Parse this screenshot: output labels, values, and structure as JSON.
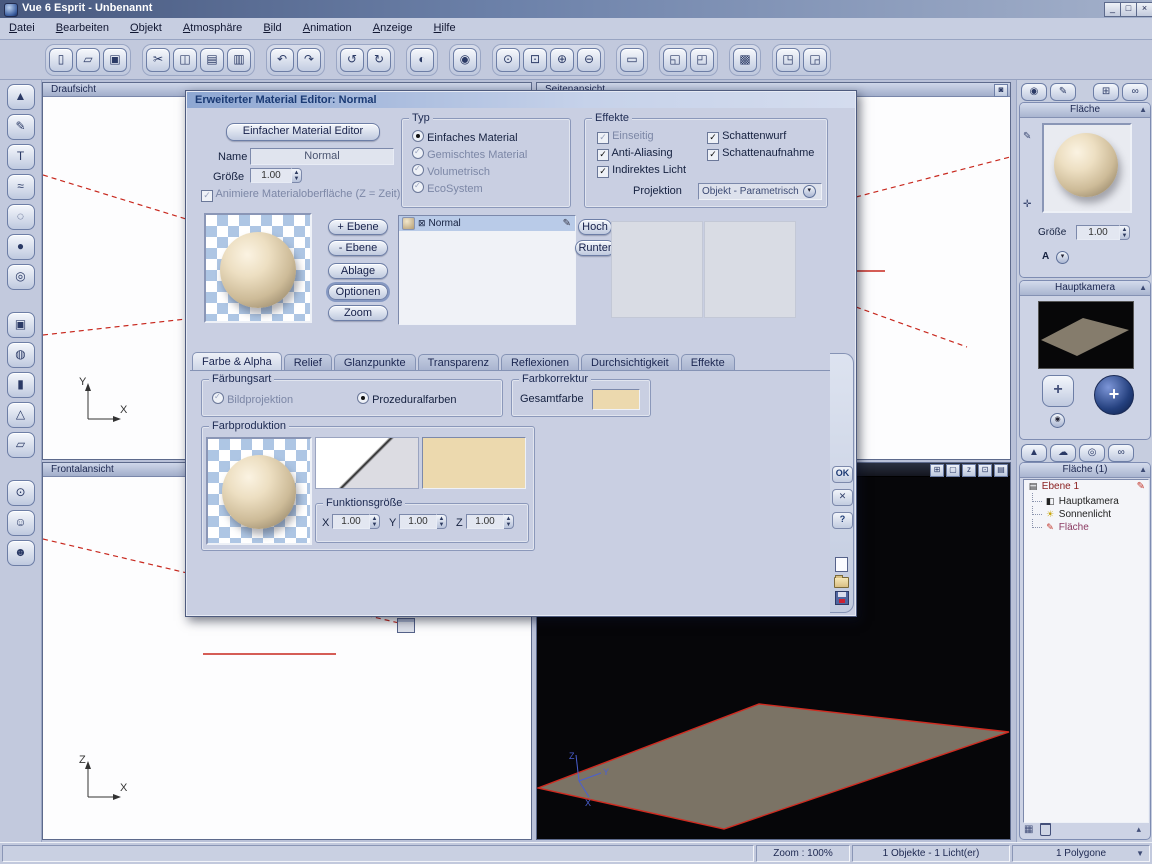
{
  "window": {
    "title": "Vue 6 Esprit - Unbenannt",
    "buttons": {
      "minimize": "_",
      "maximize": "□",
      "close": "×"
    }
  },
  "menubar": {
    "items": [
      {
        "label": "Datei"
      },
      {
        "label": "Bearbeiten"
      },
      {
        "label": "Objekt"
      },
      {
        "label": "Atmosphäre"
      },
      {
        "label": "Bild"
      },
      {
        "label": "Animation"
      },
      {
        "label": "Anzeige"
      },
      {
        "label": "Hilfe"
      }
    ]
  },
  "toolbar": {
    "groups": [
      {
        "items": [
          {
            "name": "new-scene-icon",
            "glyph": "▯"
          },
          {
            "name": "open-scene-icon",
            "glyph": "▱"
          },
          {
            "name": "save-scene-icon",
            "glyph": "▣"
          }
        ]
      },
      {
        "items": [
          {
            "name": "cut-icon",
            "glyph": "✂"
          },
          {
            "name": "copy-icon",
            "glyph": "◫"
          },
          {
            "name": "paste-icon",
            "glyph": "▤"
          },
          {
            "name": "duplicate-icon",
            "glyph": "▥"
          }
        ]
      },
      {
        "items": [
          {
            "name": "undo-icon",
            "glyph": "↶"
          },
          {
            "name": "redo-icon",
            "glyph": "↷"
          }
        ]
      },
      {
        "items": [
          {
            "name": "rotate-left-icon",
            "glyph": "↺"
          },
          {
            "name": "rotate-right-icon",
            "glyph": "↻"
          }
        ]
      },
      {
        "items": [
          {
            "name": "render-icon",
            "glyph": "◐"
          }
        ]
      },
      {
        "items": [
          {
            "name": "visibility-icon",
            "glyph": "◉"
          }
        ]
      },
      {
        "items": [
          {
            "name": "zoom-tool-icon",
            "glyph": "⊙"
          },
          {
            "name": "zoom-region-icon",
            "glyph": "⊡"
          },
          {
            "name": "zoom-in-icon",
            "glyph": "⊕"
          },
          {
            "name": "zoom-out-icon",
            "glyph": "⊖"
          }
        ]
      },
      {
        "items": [
          {
            "name": "single-view-icon",
            "glyph": "▭"
          }
        ]
      },
      {
        "items": [
          {
            "name": "quad-view-icon",
            "glyph": "◱"
          },
          {
            "name": "layout-view-icon",
            "glyph": "◰"
          }
        ]
      },
      {
        "items": [
          {
            "name": "render-options-icon",
            "glyph": "▩"
          }
        ]
      },
      {
        "items": [
          {
            "name": "object-options-icon",
            "glyph": "◳"
          },
          {
            "name": "camera-options-icon",
            "glyph": "◲"
          }
        ]
      }
    ]
  },
  "tools": {
    "items": [
      {
        "name": "terrain-tool-icon",
        "glyph": "▲"
      },
      {
        "name": "pen-tool-icon",
        "glyph": "✎"
      },
      {
        "name": "text-tool-icon",
        "glyph": "T"
      },
      {
        "name": "curve-tool-icon",
        "glyph": "≈"
      },
      {
        "name": "lasso-tool-icon",
        "glyph": "◌"
      },
      {
        "name": "water-tool-icon",
        "glyph": "●"
      },
      {
        "name": "torus-tool-icon",
        "glyph": "◎"
      },
      {
        "name": "cube-tool-icon",
        "glyph": "▣"
      },
      {
        "name": "sphere-tool-icon",
        "glyph": "◍"
      },
      {
        "name": "cylinder-tool-icon",
        "glyph": "▮"
      },
      {
        "name": "cone-tool-icon",
        "glyph": "△"
      },
      {
        "name": "plane-tool-icon",
        "glyph": "▱"
      },
      {
        "name": "magnify-tool-icon",
        "glyph": "⊙"
      },
      {
        "name": "figure-tool-icon",
        "glyph": "☺"
      },
      {
        "name": "pose-tool-icon",
        "glyph": "☻"
      }
    ]
  },
  "viewports": {
    "top": {
      "label": "Draufsicht",
      "axis_v": "Y",
      "axis_h": "X"
    },
    "side": {
      "label": "Seitenansicht",
      "header_icon_glyph": "◙"
    },
    "front": {
      "label": "Frontalansicht",
      "axis_v": "Z",
      "axis_h": "X"
    },
    "persp": {
      "axis_x": "X",
      "axis_y": "Y",
      "axis_z": "Z",
      "header_icons": [
        {
          "name": "pan-view-icon",
          "glyph": "⊞"
        },
        {
          "name": "frame-view-icon",
          "glyph": "▢"
        },
        {
          "name": "zoom-view-icon",
          "glyph": "z"
        },
        {
          "name": "grid-view-icon",
          "glyph": "⊡"
        },
        {
          "name": "display-mode-icon",
          "glyph": "▤"
        }
      ]
    }
  },
  "dialog": {
    "title": "Erweiterter Material Editor: Normal",
    "simple_editor_button": "Einfacher Material Editor",
    "name_label": "Name",
    "name_value": "Normal",
    "size_label": "Größe",
    "size_value": "1.00",
    "animate_label": "Animiere Materialoberfläche (Z = Zeit)",
    "typ": {
      "title": "Typ",
      "options": [
        {
          "label": "Einfaches Material"
        },
        {
          "label": "Gemischtes Material"
        },
        {
          "label": "Volumetrisch"
        },
        {
          "label": "EcoSystem"
        }
      ]
    },
    "effects": {
      "title": "Effekte",
      "einseitig": "Einseitig",
      "anti_aliasing": "Anti-Aliasing",
      "indirektes_licht": "Indirektes Licht",
      "schattenwurf": "Schattenwurf",
      "schattenaufnahme": "Schattenaufnahme",
      "projection_label": "Projektion",
      "projection_value": "Objekt - Parametrisch"
    },
    "layer_buttons": {
      "add": "+ Ebene",
      "remove": "- Ebene",
      "store": "Ablage",
      "options": "Optionen",
      "zoom": "Zoom"
    },
    "layers": [
      {
        "label": "Normal",
        "visibility_glyph": "⊠"
      }
    ],
    "move_up": "Hoch",
    "move_down": "Runter",
    "tabs": [
      {
        "label": "Farbe & Alpha"
      },
      {
        "label": "Relief"
      },
      {
        "label": "Glanzpunkte"
      },
      {
        "label": "Transparenz"
      },
      {
        "label": "Reflexionen"
      },
      {
        "label": "Durchsichtigkeit"
      },
      {
        "label": "Effekte"
      }
    ],
    "faerbungsart": {
      "title": "Färbungsart",
      "bildprojektion": "Bildprojektion",
      "prozeduralfarben": "Prozeduralfarben"
    },
    "farbkorrektur": {
      "title": "Farbkorrektur",
      "gesamtfarbe_label": "Gesamtfarbe",
      "gesamtfarbe_color": "#ecd9ae"
    },
    "farbproduktion": {
      "title": "Farbproduktion",
      "funktionsgroesse_label": "Funktionsgröße",
      "x_label": "X",
      "y_label": "Y",
      "z_label": "Z",
      "x_value": "1.00",
      "y_value": "1.00",
      "z_value": "1.00"
    },
    "side_buttons": {
      "ok": "OK",
      "cancel": "✕",
      "help": "?"
    }
  },
  "right_panel": {
    "top_icons": [
      {
        "name": "material-sphere-icon",
        "glyph": "◉"
      },
      {
        "name": "paint-icon",
        "glyph": "✎"
      },
      {
        "name": "plane-grid-icon",
        "glyph": "⊞"
      },
      {
        "name": "link-icon",
        "glyph": "∞"
      }
    ],
    "surface": {
      "title": "Fläche",
      "size_label": "Größe",
      "size_value": "1.00",
      "a_label": "A",
      "side_icons": [
        {
          "name": "edit-material-icon",
          "glyph": "✎"
        },
        {
          "name": "material-options-icon",
          "glyph": "✛"
        }
      ]
    },
    "camera": {
      "title": "Hauptkamera"
    },
    "panel_tabs": [
      {
        "name": "terrain-tab-icon",
        "glyph": "▲"
      },
      {
        "name": "clouds-tab-icon",
        "glyph": "☁"
      },
      {
        "name": "rings-tab-icon",
        "glyph": "◎"
      },
      {
        "name": "links-tab-icon",
        "glyph": "∞"
      }
    ],
    "scene": {
      "title": "Fläche (1)",
      "edit_pen_glyph": "✎",
      "tree": [
        {
          "label": "Ebene 1",
          "icon": "layers-icon",
          "glyph": "▤"
        },
        {
          "label": "Hauptkamera",
          "icon": "camera-icon",
          "glyph": "◧"
        },
        {
          "label": "Sonnenlicht",
          "icon": "sun-icon",
          "glyph": "☀"
        },
        {
          "label": "Fläche",
          "icon": "surface-icon",
          "glyph": "✎"
        }
      ]
    },
    "bottom_icons": [
      {
        "name": "grid-icon",
        "glyph": "▦"
      },
      {
        "name": "collapse-icon",
        "glyph": "▴"
      }
    ]
  },
  "statusbar": {
    "zoom": "Zoom : 100%",
    "objects": "1 Objekte - 1 Licht(er)",
    "polygons": "1 Polygone",
    "dropdown_glyph": "▼"
  },
  "colors": {
    "selection": "#b9cbe8",
    "swatch_beige": "#ecd9ae",
    "plane_fill": "#7b7365",
    "plane_outline": "#cf2b20",
    "viewport_guides": "#c8281e"
  }
}
